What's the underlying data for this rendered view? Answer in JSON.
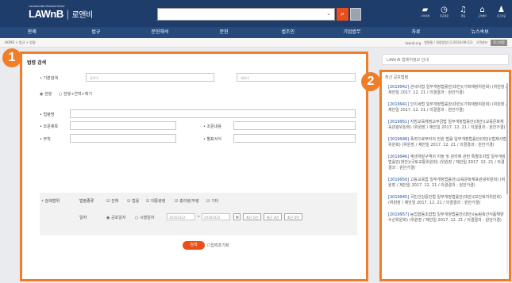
{
  "header": {
    "logo_small": "Law Information Research Service",
    "logo": "LAWnB",
    "logo_kr": "로앤비",
    "search_placeholder": "",
    "search_icon": "search-icon",
    "icons": [
      {
        "name": "folder-icon",
        "glyph": "▰",
        "label": "나의서재"
      },
      {
        "name": "history-icon",
        "glyph": "◷",
        "label": "최근열람"
      },
      {
        "name": "bell-icon",
        "glyph": "♫",
        "label": "알림"
      },
      {
        "name": "chat-icon",
        "glyph": "⌂",
        "label": "고객센터"
      },
      {
        "name": "user-icon",
        "glyph": "♟",
        "label": "로그아웃"
      }
    ]
  },
  "menu": [
    "판례",
    "법규",
    "문헌해석",
    "문헌",
    "법조인",
    "기업법무",
    "자료",
    "뉴스속보"
  ],
  "breadcrumb": {
    "path": "HOME > 법규 > 법령",
    "right": [
      "lawnb.org",
      "법령통 / 개정법령 (1-2018-09-22)",
      "고객센터"
    ],
    "button": "로그아웃"
  },
  "panel": {
    "title": "법령 검색",
    "basic_label": "• 기본검색",
    "basic_placeholder_1": "검색어",
    "basic_placeholder_2": "제외어",
    "radios": [
      "현행",
      "현행+연혁+예기"
    ],
    "law_name_label": "• 법령명",
    "article_no_label": "• 조문제목",
    "article_content_label": "• 조문내용",
    "appendix_label": "• 부칙",
    "appendix_form_label": "• 별표서식",
    "range_label": "• 검색범위",
    "law_type_label": "법령종류",
    "checkboxes": [
      "전체",
      "법률",
      "대통령령",
      "총리령/부령",
      "기타"
    ],
    "date_label": "일자",
    "date_radios": [
      "공포일자",
      "시행일자"
    ],
    "date_from": "20161022",
    "date_to": "20181022",
    "periods": [
      "최근 1년",
      "최근 3년",
      "최근 5년"
    ],
    "search_button": "검색",
    "reset": "입력조기화"
  },
  "badges": [
    "1",
    "2"
  ],
  "right": {
    "title": "LAWnB 법제처정보 안내",
    "header": "최신 공포법령",
    "entries": [
      {
        "code": "[2019942]",
        "text": "관세사법 일부개정법률안(대안)(기획재정위원회) (위원장 / 제안일 2017. 12. 21 / 의결결과 : 원안가결)"
      },
      {
        "code": "[2019941]",
        "text": "인지세법 일부개정법률안(대안)(기획재정위원회) (위원장 / 제안일 2017. 12. 21 / 의결결과 : 원안가결)"
      },
      {
        "code": "[2019951]",
        "text": "지방교육재정교부금법 일부개정법률안(대안)(교육문화체육관광위원회) (위원장 / 제안일 2017. 12. 21 / 의결결과 : 원안가결)"
      },
      {
        "code": "[2019948]",
        "text": "폭력으로부터의 전원 법률 일부개정법률안(대안)(법제사법위원회) (위원장 / 제안일 2017. 12. 21 / 의결결과 : 원안가결)"
      },
      {
        "code": "[2019946]",
        "text": "재생개발구역의 지정 및 관리에 관한 특별조치법 일부개정법률안(대안)(국토교통위원회) (위원장 / 제안일 2017. 12. 21 / 의결결과 : 원안가결)"
      },
      {
        "code": "[2019950]",
        "text": "고등교육법 일부개정법률안(교육문화체육관광위원회) (위원장 / 제안일 2017. 12. 21 / 의결결과 : 원안가결)"
      },
      {
        "code": "[2019945]",
        "text": "국민건강증진법 일부개정법률안(대안)(보건복지위원회) (위원장 / 제안일 2017. 12. 21 / 의결결과 : 원안가결)"
      },
      {
        "code": "[2019957]",
        "text": "농업협동조합법 일부개정법률안(대안)(농림축산식품해양수산위원회) (위원장 / 제안일 2017. 12. 21 / 의결결과 : 원안가결)"
      }
    ]
  }
}
